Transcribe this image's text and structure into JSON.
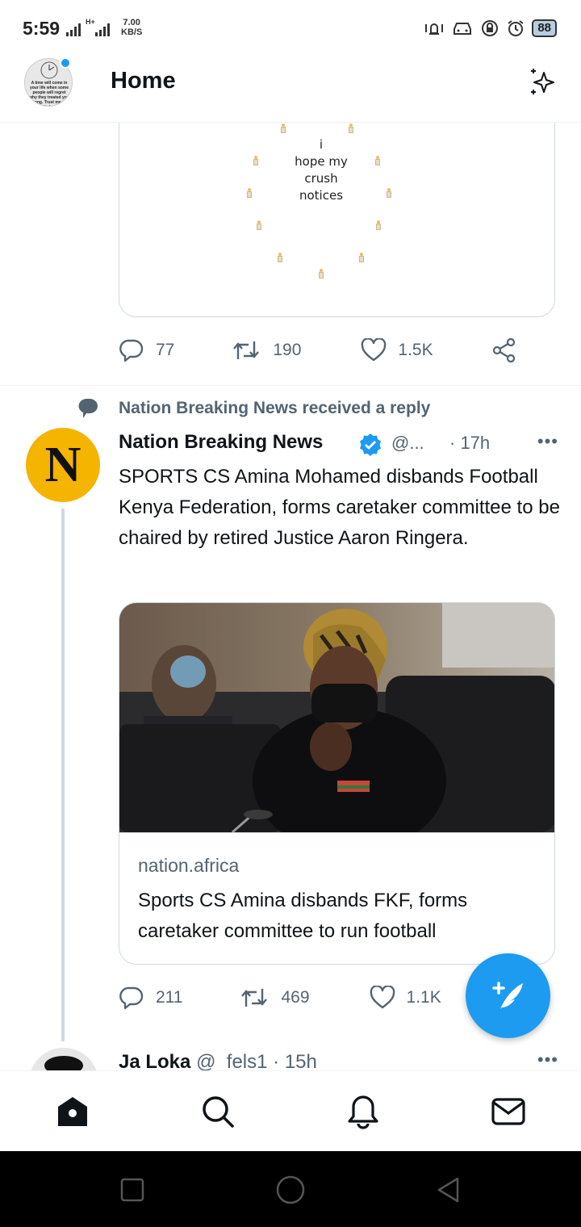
{
  "status_bar": {
    "time": "5:59",
    "net_speed_value": "7.00",
    "net_speed_unit": "KB/S",
    "network_label": "H+",
    "battery": "88"
  },
  "header": {
    "title": "Home",
    "avatar_caption": "A time will come in your life when some people will regret why they treated you wrong. Trust me will definitely come"
  },
  "previous_tweet": {
    "image_text": "i\nhope my\ncrush\nnotices",
    "replies": "77",
    "retweets": "190",
    "likes": "1.5K"
  },
  "tweet": {
    "context": "Nation Breaking News received a reply",
    "avatar_letter": "N",
    "name": "Nation Breaking News",
    "handle": "@...",
    "time": "· 17h",
    "text": "SPORTS CS Amina Mohamed disbands Football Kenya Federation, forms caretaker committee to be chaired by retired Justice Aaron Ringera.",
    "link": {
      "domain": "nation.africa",
      "title": "Sports CS Amina disbands FKF, forms caretaker committee to run football"
    },
    "replies": "211",
    "retweets": "469",
    "likes": "1.1K"
  },
  "next_tweet": {
    "name": "Ja Loka",
    "handle": "@_fels1",
    "time": "· 15h"
  },
  "colors": {
    "accent": "#1d9bf0",
    "muted": "#536471",
    "border": "#cfd9de",
    "nation_yellow": "#f4b400"
  },
  "icons": [
    "sparkle-icon",
    "reply-icon",
    "retweet-icon",
    "like-icon",
    "share-icon",
    "verified-icon",
    "home-icon",
    "search-icon",
    "bell-icon",
    "mail-icon",
    "compose-icon"
  ]
}
